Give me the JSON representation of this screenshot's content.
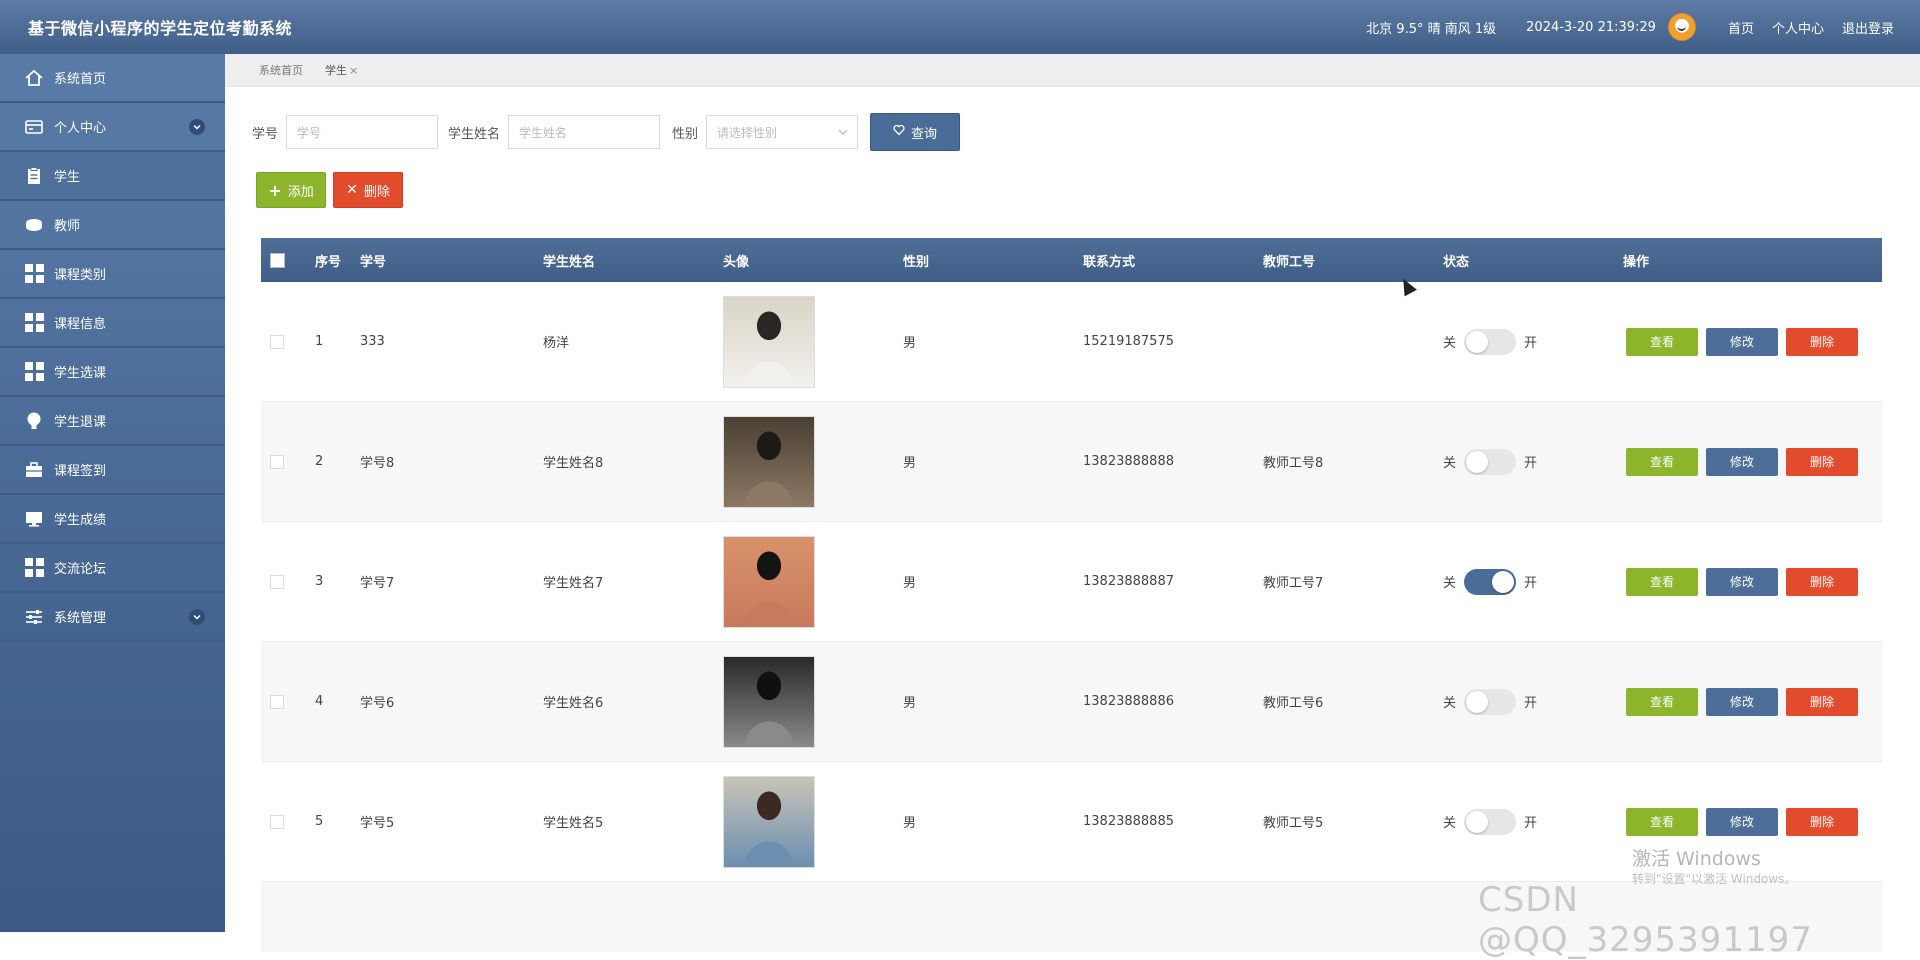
{
  "app": {
    "title": "基于微信小程序的学生定位考勤系统"
  },
  "header": {
    "weather": "北京 9.5° 晴 南风 1级",
    "datetime": "2024-3-20 21:39:29",
    "nav": [
      "首页",
      "个人中心",
      "退出登录"
    ]
  },
  "sidebar": {
    "items": [
      {
        "label": "系统首页",
        "icon": "home-icon"
      },
      {
        "label": "个人中心",
        "icon": "card-icon",
        "expandable": true
      },
      {
        "label": "学生",
        "icon": "clipboard-icon",
        "active": true
      },
      {
        "label": "教师",
        "icon": "disk-icon"
      },
      {
        "label": "课程类别",
        "icon": "grid-icon"
      },
      {
        "label": "课程信息",
        "icon": "grid-icon"
      },
      {
        "label": "学生选课",
        "icon": "grid-icon"
      },
      {
        "label": "学生退课",
        "icon": "bulb-icon"
      },
      {
        "label": "课程签到",
        "icon": "briefcase-icon"
      },
      {
        "label": "学生成绩",
        "icon": "monitor-icon"
      },
      {
        "label": "交流论坛",
        "icon": "grid-icon"
      },
      {
        "label": "系统管理",
        "icon": "sliders-icon",
        "expandable": true
      }
    ]
  },
  "breadcrumb": {
    "home": "系统首页",
    "current": "学生",
    "close": "×"
  },
  "search": {
    "student_no_label": "学号",
    "student_no_placeholder": "学号",
    "student_name_label": "学生姓名",
    "student_name_placeholder": "学生姓名",
    "gender_label": "性别",
    "gender_placeholder": "请选择性别",
    "query_label": "查询"
  },
  "actions": {
    "add_label": "添加",
    "delete_label": "删除"
  },
  "table": {
    "headers": [
      "序号",
      "学号",
      "学生姓名",
      "头像",
      "性别",
      "联系方式",
      "教师工号",
      "状态",
      "操作"
    ],
    "toggle_off": "关",
    "toggle_on": "开",
    "op_view": "查看",
    "op_edit": "修改",
    "op_delete": "删除",
    "rows": [
      {
        "index": "1",
        "student_no": "333",
        "name": "杨洋",
        "gender": "男",
        "phone": "15219187575",
        "teacher_no": "",
        "status_on": false,
        "photo_colors": [
          "#d9d4c7",
          "#f2f1ec",
          "#2b2623"
        ]
      },
      {
        "index": "2",
        "student_no": "学号8",
        "name": "学生姓名8",
        "gender": "男",
        "phone": "13823888888",
        "teacher_no": "教师工号8",
        "status_on": false,
        "photo_colors": [
          "#4a4033",
          "#8c7864",
          "#1c1a17"
        ]
      },
      {
        "index": "3",
        "student_no": "学号7",
        "name": "学生姓名7",
        "gender": "男",
        "phone": "13823888887",
        "teacher_no": "教师工号7",
        "status_on": true,
        "photo_colors": [
          "#d9926c",
          "#c77a5c",
          "#141414"
        ]
      },
      {
        "index": "4",
        "student_no": "学号6",
        "name": "学生姓名6",
        "gender": "男",
        "phone": "13823888886",
        "teacher_no": "教师工号6",
        "status_on": false,
        "photo_colors": [
          "#2a2a2a",
          "#8a8a8a",
          "#101010"
        ]
      },
      {
        "index": "5",
        "student_no": "学号5",
        "name": "学生姓名5",
        "gender": "男",
        "phone": "13823888885",
        "teacher_no": "教师工号5",
        "status_on": false,
        "photo_colors": [
          "#c9c4b8",
          "#6b8fb0",
          "#3a2a22"
        ]
      }
    ]
  },
  "watermarks": {
    "windows_title": "激活 Windows",
    "windows_sub": "转到\"设置\"以激活 Windows。",
    "csdn": "CSDN @QQ_3295391197"
  }
}
